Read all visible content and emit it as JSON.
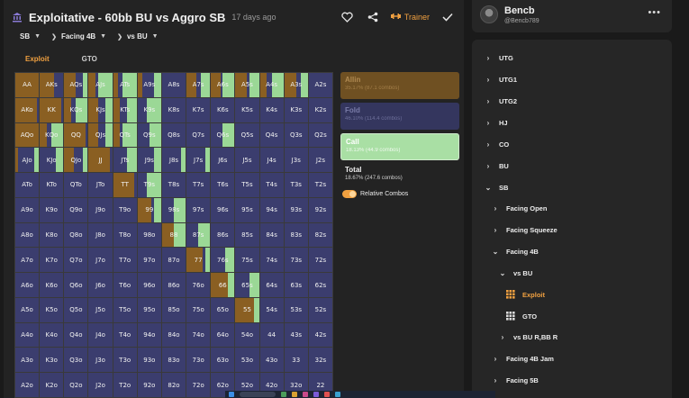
{
  "header": {
    "title": "Exploitative - 60bb BU vs Aggro SB",
    "age": "17 days ago",
    "trainer_label": "Trainer"
  },
  "breadcrumbs": [
    "SB",
    "Facing 4B",
    "vs BU"
  ],
  "tabs": [
    "Exploit",
    "GTO"
  ],
  "grid": {
    "rows": [
      [
        "AA",
        "AKs",
        "AQs",
        "AJs",
        "ATs",
        "A9s",
        "A8s",
        "A7s",
        "A6s",
        "A5s",
        "A4s",
        "A3s",
        "A2s"
      ],
      [
        "AKo",
        "KK",
        "KQs",
        "KJs",
        "KTs",
        "K9s",
        "K8s",
        "K7s",
        "K6s",
        "K5s",
        "K4s",
        "K3s",
        "K2s"
      ],
      [
        "AQo",
        "KQo",
        "QQ",
        "QJs",
        "QTs",
        "Q9s",
        "Q8s",
        "Q7s",
        "Q6s",
        "Q5s",
        "Q4s",
        "Q3s",
        "Q2s"
      ],
      [
        "AJo",
        "KJo",
        "QJo",
        "JJ",
        "JTs",
        "J9s",
        "J8s",
        "J7s",
        "J6s",
        "J5s",
        "J4s",
        "J3s",
        "J2s"
      ],
      [
        "ATo",
        "KTo",
        "QTo",
        "JTo",
        "TT",
        "T9s",
        "T8s",
        "T7s",
        "T6s",
        "T5s",
        "T4s",
        "T3s",
        "T2s"
      ],
      [
        "A9o",
        "K9o",
        "Q9o",
        "J9o",
        "T9o",
        "99",
        "98s",
        "97s",
        "96s",
        "95s",
        "94s",
        "93s",
        "92s"
      ],
      [
        "A8o",
        "K8o",
        "Q8o",
        "J8o",
        "T8o",
        "98o",
        "88",
        "87s",
        "86s",
        "85s",
        "84s",
        "83s",
        "82s"
      ],
      [
        "A7o",
        "K7o",
        "Q7o",
        "J7o",
        "T7o",
        "97o",
        "87o",
        "77",
        "76s",
        "75s",
        "74s",
        "73s",
        "72s"
      ],
      [
        "A6o",
        "K6o",
        "Q6o",
        "J6o",
        "T6o",
        "96o",
        "86o",
        "76o",
        "66",
        "65s",
        "64s",
        "63s",
        "62s"
      ],
      [
        "A5o",
        "K5o",
        "Q5o",
        "J5o",
        "T5o",
        "95o",
        "85o",
        "75o",
        "65o",
        "55",
        "54s",
        "53s",
        "52s"
      ],
      [
        "A4o",
        "K4o",
        "Q4o",
        "J4o",
        "T4o",
        "94o",
        "84o",
        "74o",
        "64o",
        "54o",
        "44",
        "43s",
        "42s"
      ],
      [
        "A3o",
        "K3o",
        "Q3o",
        "J3o",
        "T3o",
        "93o",
        "83o",
        "73o",
        "63o",
        "53o",
        "43o",
        "33",
        "32s"
      ],
      [
        "A2o",
        "K2o",
        "Q2o",
        "J2o",
        "T2o",
        "92o",
        "82o",
        "72o",
        "62o",
        "52o",
        "42o",
        "32o",
        "22"
      ]
    ],
    "freqs": [
      [
        [
          1,
          0,
          0
        ],
        [
          0.6,
          0.4,
          0
        ],
        [
          0.5,
          0.3,
          0.2
        ],
        [
          0.3,
          0.1,
          0.6
        ],
        [
          0.2,
          0.2,
          0.6
        ],
        [
          0.2,
          0.5,
          0.3
        ],
        [
          0,
          1,
          0
        ],
        [
          0.4,
          0.2,
          0.4
        ],
        [
          0.4,
          0.1,
          0.5
        ],
        [
          0.5,
          0.1,
          0.4
        ],
        [
          0.3,
          0.2,
          0.5
        ],
        [
          0.5,
          0.2,
          0.3
        ],
        [
          0,
          1,
          0
        ]
      ],
      [
        [
          0.9,
          0.1,
          0
        ],
        [
          0.9,
          0.1,
          0
        ],
        [
          0.3,
          0.2,
          0.5
        ],
        [
          0.4,
          0.3,
          0.3
        ],
        [
          0.3,
          0.3,
          0.4
        ],
        [
          0,
          0.4,
          0.6
        ],
        [
          0,
          1,
          0
        ],
        [
          0,
          1,
          0
        ],
        [
          0,
          1,
          0
        ],
        [
          0,
          1,
          0
        ],
        [
          0,
          1,
          0
        ],
        [
          0,
          1,
          0
        ],
        [
          0,
          1,
          0
        ]
      ],
      [
        [
          1,
          0,
          0
        ],
        [
          0.3,
          0.2,
          0.5
        ],
        [
          0.9,
          0.1,
          0
        ],
        [
          0.4,
          0.3,
          0.3
        ],
        [
          0.3,
          0.1,
          0.6
        ],
        [
          0,
          0.5,
          0.5
        ],
        [
          0,
          1,
          0
        ],
        [
          0,
          1,
          0
        ],
        [
          0,
          0.5,
          0.5
        ],
        [
          0,
          1,
          0
        ],
        [
          0,
          1,
          0
        ],
        [
          0,
          1,
          0
        ],
        [
          0,
          1,
          0
        ]
      ],
      [
        [
          0.1,
          0.7,
          0.2
        ],
        [
          0,
          0.7,
          0.3
        ],
        [
          0.4,
          0.4,
          0.2
        ],
        [
          0.9,
          0.1,
          0
        ],
        [
          0,
          0.6,
          0.4
        ],
        [
          0,
          0.7,
          0.3
        ],
        [
          0,
          0.8,
          0.2
        ],
        [
          0,
          0.8,
          0.2
        ],
        [
          0,
          1,
          0
        ],
        [
          0,
          1,
          0
        ],
        [
          0,
          1,
          0
        ],
        [
          0,
          1,
          0
        ],
        [
          0,
          1,
          0
        ]
      ],
      [
        [
          0,
          1,
          0
        ],
        [
          0,
          1,
          0
        ],
        [
          0,
          1,
          0
        ],
        [
          0,
          1,
          0
        ],
        [
          0.9,
          0.1,
          0
        ],
        [
          0,
          0.4,
          0.6
        ],
        [
          0,
          1,
          0
        ],
        [
          0,
          1,
          0
        ],
        [
          0,
          1,
          0
        ],
        [
          0,
          1,
          0
        ],
        [
          0,
          1,
          0
        ],
        [
          0,
          1,
          0
        ],
        [
          0,
          1,
          0
        ]
      ],
      [
        [
          0,
          1,
          0
        ],
        [
          0,
          1,
          0
        ],
        [
          0,
          1,
          0
        ],
        [
          0,
          1,
          0
        ],
        [
          0,
          1,
          0
        ],
        [
          0.6,
          0.1,
          0.3
        ],
        [
          0,
          0.5,
          0.5
        ],
        [
          0,
          1,
          0
        ],
        [
          0,
          1,
          0
        ],
        [
          0,
          1,
          0
        ],
        [
          0,
          1,
          0
        ],
        [
          0,
          1,
          0
        ],
        [
          0,
          1,
          0
        ]
      ],
      [
        [
          0,
          1,
          0
        ],
        [
          0,
          1,
          0
        ],
        [
          0,
          1,
          0
        ],
        [
          0,
          1,
          0
        ],
        [
          0,
          1,
          0
        ],
        [
          0,
          1,
          0
        ],
        [
          0.5,
          0,
          0.5
        ],
        [
          0,
          0.5,
          0.5
        ],
        [
          0,
          1,
          0
        ],
        [
          0,
          1,
          0
        ],
        [
          0,
          1,
          0
        ],
        [
          0,
          1,
          0
        ],
        [
          0,
          1,
          0
        ]
      ],
      [
        [
          0,
          1,
          0
        ],
        [
          0,
          1,
          0
        ],
        [
          0,
          1,
          0
        ],
        [
          0,
          1,
          0
        ],
        [
          0,
          1,
          0
        ],
        [
          0,
          1,
          0
        ],
        [
          0,
          1,
          0
        ],
        [
          0.7,
          0.1,
          0.2
        ],
        [
          0,
          0.6,
          0.4
        ],
        [
          0,
          1,
          0
        ],
        [
          0,
          1,
          0
        ],
        [
          0,
          1,
          0
        ],
        [
          0,
          1,
          0
        ]
      ],
      [
        [
          0,
          1,
          0
        ],
        [
          0,
          1,
          0
        ],
        [
          0,
          1,
          0
        ],
        [
          0,
          1,
          0
        ],
        [
          0,
          1,
          0
        ],
        [
          0,
          1,
          0
        ],
        [
          0,
          1,
          0
        ],
        [
          0,
          1,
          0
        ],
        [
          0.7,
          0,
          0.3
        ],
        [
          0,
          0.6,
          0.4
        ],
        [
          0,
          1,
          0
        ],
        [
          0,
          1,
          0
        ],
        [
          0,
          1,
          0
        ]
      ],
      [
        [
          0,
          1,
          0
        ],
        [
          0,
          1,
          0
        ],
        [
          0,
          1,
          0
        ],
        [
          0,
          1,
          0
        ],
        [
          0,
          1,
          0
        ],
        [
          0,
          1,
          0
        ],
        [
          0,
          1,
          0
        ],
        [
          0,
          1,
          0
        ],
        [
          0,
          1,
          0
        ],
        [
          0.8,
          0,
          0.2
        ],
        [
          0,
          1,
          0
        ],
        [
          0,
          1,
          0
        ],
        [
          0,
          1,
          0
        ]
      ],
      [
        [
          0,
          1,
          0
        ],
        [
          0,
          1,
          0
        ],
        [
          0,
          1,
          0
        ],
        [
          0,
          1,
          0
        ],
        [
          0,
          1,
          0
        ],
        [
          0,
          1,
          0
        ],
        [
          0,
          1,
          0
        ],
        [
          0,
          1,
          0
        ],
        [
          0,
          1,
          0
        ],
        [
          0,
          1,
          0
        ],
        [
          0,
          1,
          0
        ],
        [
          0,
          1,
          0
        ],
        [
          0,
          1,
          0
        ]
      ],
      [
        [
          0,
          1,
          0
        ],
        [
          0,
          1,
          0
        ],
        [
          0,
          1,
          0
        ],
        [
          0,
          1,
          0
        ],
        [
          0,
          1,
          0
        ],
        [
          0,
          1,
          0
        ],
        [
          0,
          1,
          0
        ],
        [
          0,
          1,
          0
        ],
        [
          0,
          1,
          0
        ],
        [
          0,
          1,
          0
        ],
        [
          0,
          1,
          0
        ],
        [
          0,
          1,
          0
        ],
        [
          0,
          1,
          0
        ]
      ],
      [
        [
          0,
          1,
          0
        ],
        [
          0,
          1,
          0
        ],
        [
          0,
          1,
          0
        ],
        [
          0,
          1,
          0
        ],
        [
          0,
          1,
          0
        ],
        [
          0,
          1,
          0
        ],
        [
          0,
          1,
          0
        ],
        [
          0,
          1,
          0
        ],
        [
          0,
          1,
          0
        ],
        [
          0,
          1,
          0
        ],
        [
          0,
          1,
          0
        ],
        [
          0,
          1,
          0
        ],
        [
          0,
          1,
          0
        ]
      ]
    ]
  },
  "colors": {
    "raise": "#8a5f22",
    "fold": "#3b3d6e",
    "call": "#9bd896",
    "accent": "#f0a040"
  },
  "legend": {
    "raise": {
      "name": "Allin",
      "stat": "35.17% (87.1 combos)"
    },
    "fold": {
      "name": "Fold",
      "stat": "46.10% (114.4 combos)"
    },
    "call": {
      "name": "Call",
      "stat": "18.13% (44.9 combos)"
    },
    "total": {
      "name": "Total",
      "stat": "18.67% (247.6 combos)"
    },
    "relative_label": "Relative Combos"
  },
  "user": {
    "name": "Bencb",
    "handle": "@Bencb789"
  },
  "tree": [
    {
      "label": "UTG",
      "chev": "›",
      "type": "chev"
    },
    {
      "label": "UTG1",
      "chev": "›",
      "type": "chev"
    },
    {
      "label": "UTG2",
      "chev": "›",
      "type": "chev"
    },
    {
      "label": "HJ",
      "chev": "›",
      "type": "chev"
    },
    {
      "label": "CO",
      "chev": "›",
      "type": "chev"
    },
    {
      "label": "BU",
      "chev": "›",
      "type": "chev"
    },
    {
      "label": "SB",
      "chev": "⌄",
      "type": "chev"
    },
    {
      "label": "Facing Open",
      "chev": "›",
      "type": "chev"
    },
    {
      "label": "Facing Squeeze",
      "chev": "›",
      "type": "chev"
    },
    {
      "label": "Facing 4B",
      "chev": "⌄",
      "type": "chev"
    },
    {
      "label": "vs BU",
      "chev": "⌄",
      "type": "chev"
    },
    {
      "label": "Exploit",
      "chev": "",
      "type": "grid-icon",
      "active": true
    },
    {
      "label": "GTO",
      "chev": "",
      "type": "grid-icon"
    },
    {
      "label": "vs BU R,BB R",
      "chev": "›",
      "type": "chev"
    },
    {
      "label": "Facing 4B Jam",
      "chev": "›",
      "type": "chev"
    },
    {
      "label": "Facing 5B",
      "chev": "›",
      "type": "chev"
    }
  ]
}
